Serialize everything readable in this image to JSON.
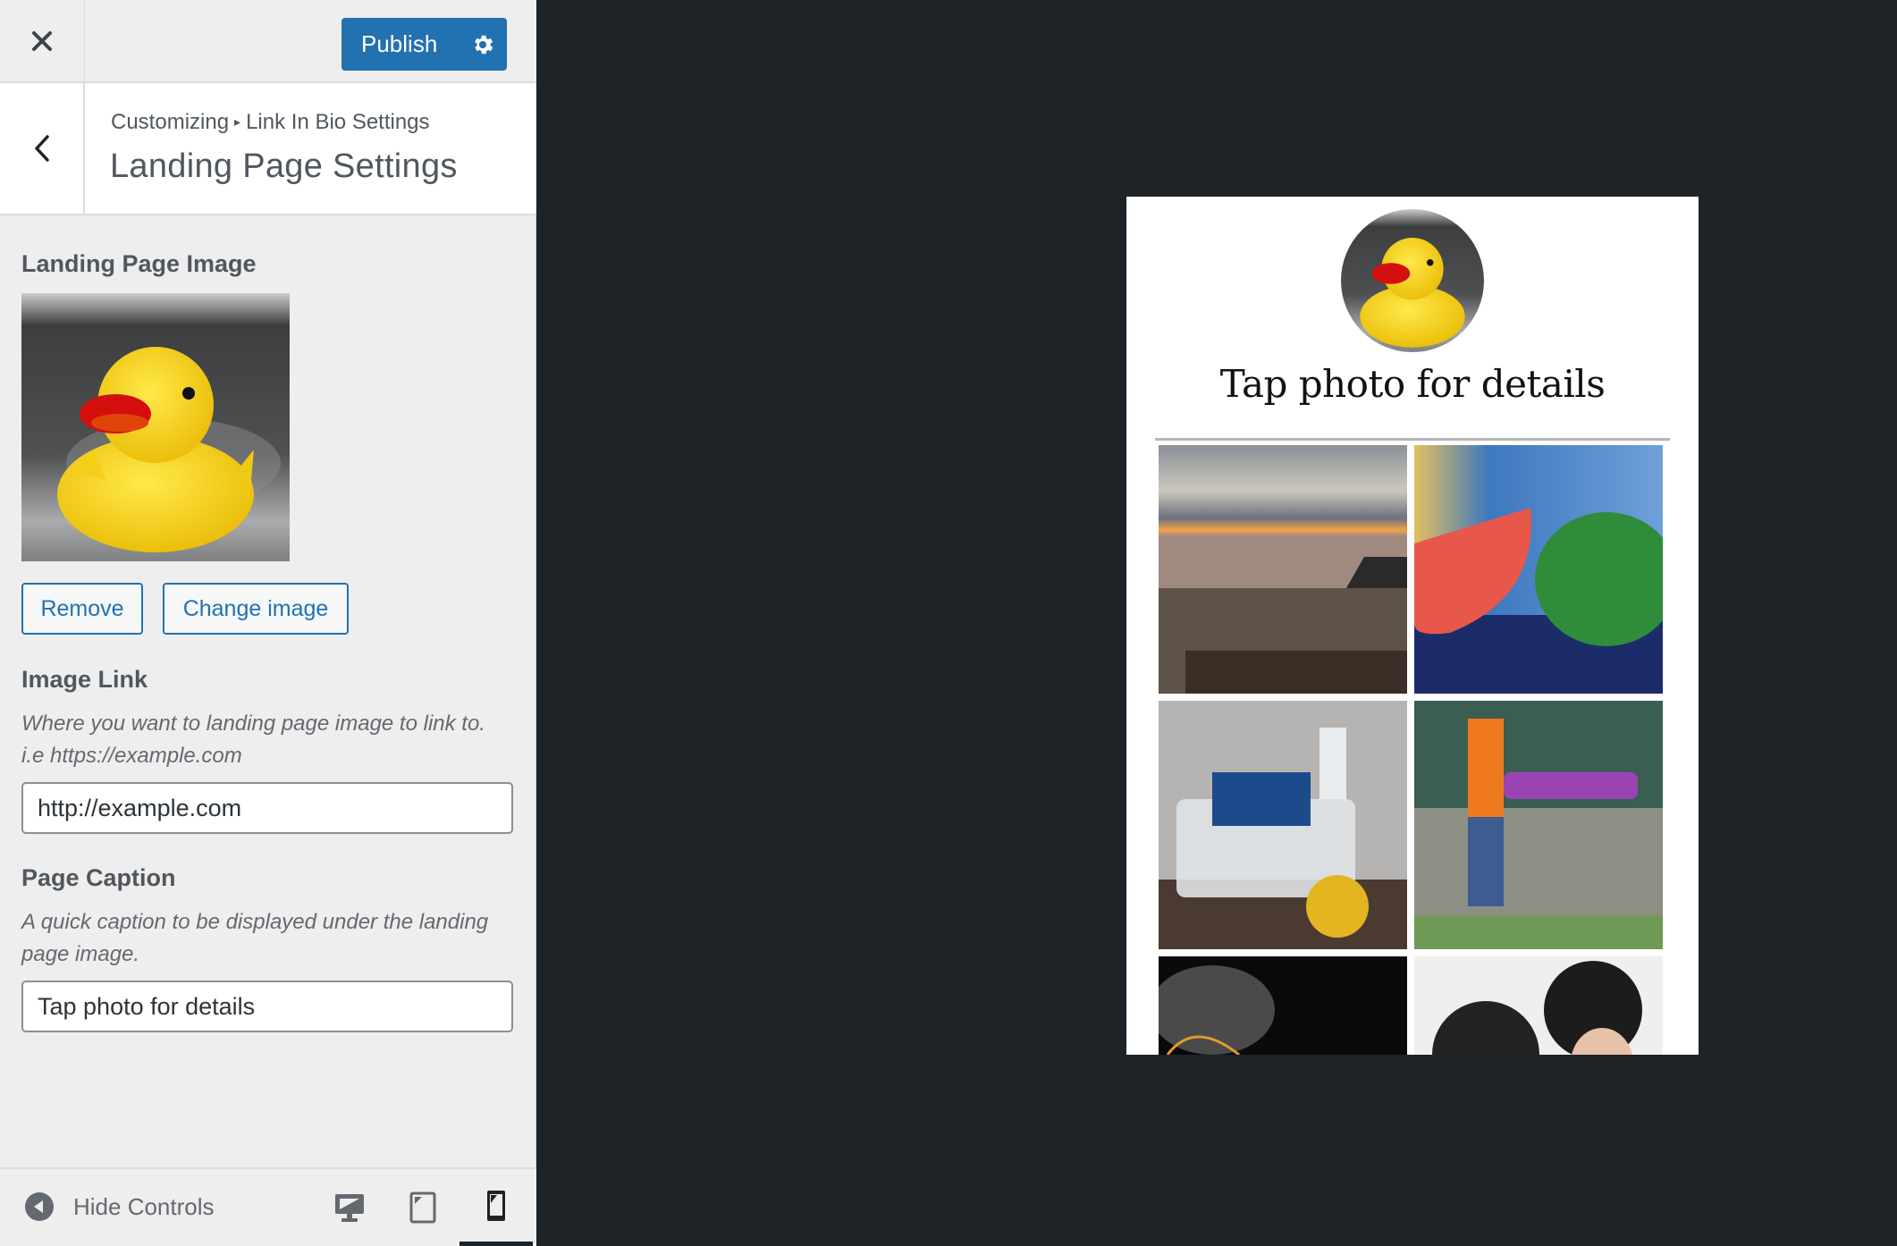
{
  "topbar": {
    "close_label": "Close",
    "publish_label": "Publish",
    "publish_settings_label": "Publish Settings"
  },
  "section": {
    "breadcrumb_root": "Customizing",
    "breadcrumb_separator": "▸",
    "breadcrumb_parent": "Link In Bio Settings",
    "title": "Landing Page Settings"
  },
  "controls": {
    "landing_image": {
      "label": "Landing Page Image",
      "remove_label": "Remove",
      "change_label": "Change image"
    },
    "image_link": {
      "label": "Image Link",
      "description": "Where you want to landing page image to link to. i.e https://example.com",
      "value": "http://example.com"
    },
    "page_caption": {
      "label": "Page Caption",
      "description": "A quick caption to be displayed under the landing page image.",
      "value": "Tap photo for details"
    }
  },
  "footer": {
    "hide_controls_label": "Hide Controls",
    "devices": [
      {
        "name": "desktop",
        "label": "Enter desktop preview mode",
        "active": false
      },
      {
        "name": "tablet",
        "label": "Enter tablet preview mode",
        "active": false
      },
      {
        "name": "mobile",
        "label": "Enter mobile preview mode",
        "active": true
      }
    ]
  },
  "preview": {
    "caption": "Tap photo for details",
    "photos": [
      {
        "subject": "beach sunset with lifeguard tower"
      },
      {
        "subject": "watermelon painting"
      },
      {
        "subject": "robot car kit"
      },
      {
        "subject": "person flying drone"
      },
      {
        "subject": "dark electronics close-up"
      },
      {
        "subject": "two children"
      }
    ]
  },
  "colors": {
    "accent": "#2271b1",
    "sidebar_bg": "#eeeeee",
    "preview_bg": "#1d2327"
  }
}
